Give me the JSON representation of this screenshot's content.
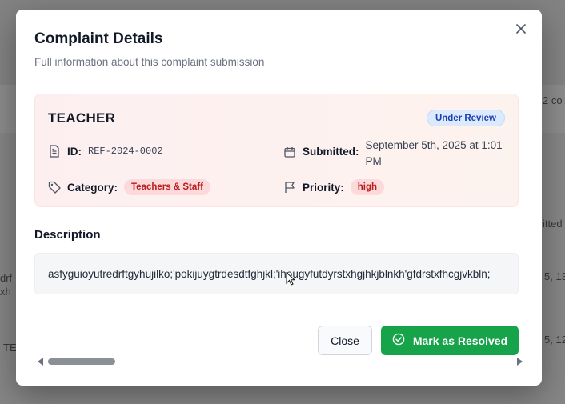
{
  "background": {
    "fragments": [
      "2 co",
      "itted",
      "drf",
      "xh",
      "5, 13",
      "TE",
      "5, 12"
    ]
  },
  "modal": {
    "title": "Complaint Details",
    "subtitle": "Full information about this complaint submission",
    "close_icon": "close-icon"
  },
  "complaint": {
    "role": "TEACHER",
    "status": "Under Review",
    "id_label": "ID:",
    "id_value": "REF-2024-0002",
    "submitted_label": "Submitted:",
    "submitted_value": "September 5th, 2025 at 1:01 PM",
    "category_label": "Category:",
    "category_value": "Teachers & Staff",
    "priority_label": "Priority:",
    "priority_value": "high"
  },
  "description": {
    "heading": "Description",
    "text": "asfyguioyutredrftgyhujilko;'pokijuygtrdesdtfghjkl;'ihougyfutdyrstxhgjhkjblnkh'gfdrstxfhcgjvkbln;"
  },
  "actions": {
    "close_label": "Close",
    "resolve_label": "Mark as Resolved"
  },
  "colors": {
    "accent_green": "#16a34a",
    "status_blue": "#1e40af",
    "chip_red": "#b91c1c"
  }
}
